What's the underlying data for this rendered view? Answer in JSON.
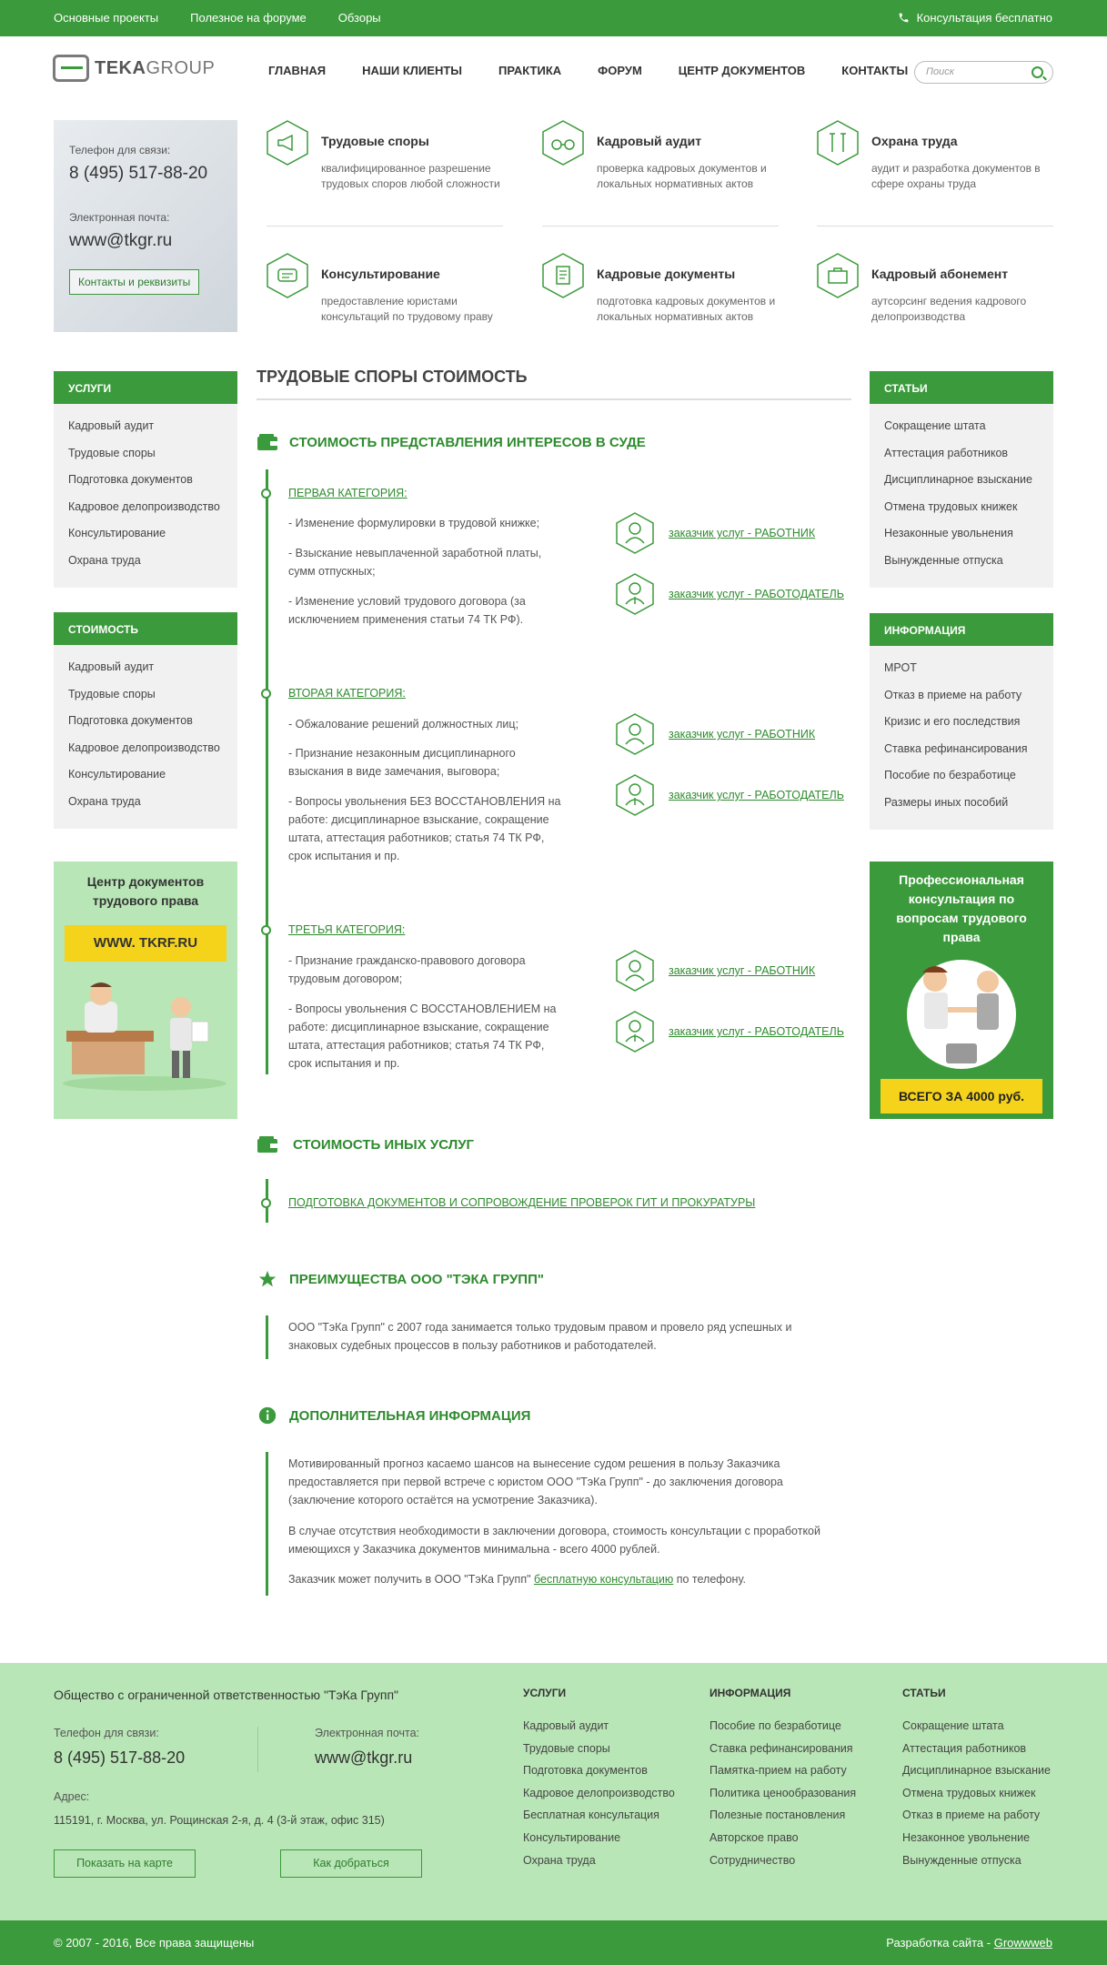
{
  "topbar": {
    "links": [
      "Основные проекты",
      "Полезное на форуме",
      "Обзоры"
    ],
    "consult": "Консультация бесплатно"
  },
  "header": {
    "logo_a": "TEKA",
    "logo_b": "GROUP",
    "nav": [
      "ГЛАВНАЯ",
      "НАШИ КЛИЕНТЫ",
      "ПРАКТИКА",
      "ФОРУМ",
      "ЦЕНТР ДОКУМЕНТОВ",
      "КОНТАКТЫ"
    ],
    "search_placeholder": "Поиск"
  },
  "contact_card": {
    "phone_label": "Телефон для связи:",
    "phone": "8 (495) 517-88-20",
    "email_label": "Электронная почта:",
    "email": "www@tkgr.ru",
    "button": "Контакты и реквизиты"
  },
  "services": [
    {
      "title": "Трудовые споры",
      "desc": "квалифицированное разрешение трудовых споров любой сложности"
    },
    {
      "title": "Кадровый аудит",
      "desc": "проверка кадровых документов и локальных нормативных актов"
    },
    {
      "title": "Охрана труда",
      "desc": "аудит и разработка документов в сфере охраны труда"
    },
    {
      "title": "Консультирование",
      "desc": "предоставление юристами консультаций по трудовому праву"
    },
    {
      "title": "Кадровые документы",
      "desc": "подготовка кадровых документов и локальных нормативных актов"
    },
    {
      "title": "Кадровый абонемент",
      "desc": "аутсорсинг ведения кадрового делопроизводства"
    }
  ],
  "left_sidebar": {
    "services_title": "УСЛУГИ",
    "services": [
      "Кадровый аудит",
      "Трудовые споры",
      "Подготовка документов",
      "Кадровое делопроизводство",
      "Консультирование",
      "Охрана труда"
    ],
    "cost_title": "СТОИМОСТЬ",
    "cost": [
      "Кадровый аудит",
      "Трудовые споры",
      "Подготовка документов",
      "Кадровое делопроизводство",
      "Консультирование",
      "Охрана труда"
    ],
    "promo_title": "Центр документов трудового права",
    "promo_site": "WWW. TKRF.RU"
  },
  "right_sidebar": {
    "articles_title": "СТАТЬИ",
    "articles": [
      "Сокращение штата",
      "Аттестация работников",
      "Дисциплинарное взыскание",
      "Отмена трудовых книжек",
      "Незаконные увольнения",
      "Вынужденные отпуска"
    ],
    "info_title": "ИНФОРМАЦИЯ",
    "info": [
      "МРОТ",
      "Отказ в приеме на работу",
      "Кризис и его последствия",
      "Ставка рефинансирования",
      "Пособие по безработице",
      "Размеры иных пособий"
    ],
    "promo_title": "Профессиональная консультация по вопросам трудового права",
    "promo_price": "ВСЕГО ЗА 4000 руб."
  },
  "main": {
    "title": "ТРУДОВЫЕ СПОРЫ СТОИМОСТЬ",
    "court_title": "СТОИМОСТЬ ПРЕДСТАВЛЕНИЯ ИНТЕРЕСОВ В СУДЕ",
    "employee_link": "заказчик услуг - РАБОТНИК",
    "employer_link": "заказчик услуг - РАБОТОДАТЕЛЬ",
    "categories": [
      {
        "name": "ПЕРВАЯ КАТЕГОРИЯ:",
        "items": [
          "- Изменение формулировки в трудовой книжке;",
          "- Взыскание невыплаченной заработной платы, сумм отпускных;",
          "- Изменение условий трудового договора (за исключением применения статьи 74 ТК РФ)."
        ]
      },
      {
        "name": "ВТОРАЯ КАТЕГОРИЯ:",
        "items": [
          "- Обжалование решений должностных лиц;",
          "- Признание незаконным дисциплинарного взыскания в виде замечания, выговора;",
          "- Вопросы увольнения БЕЗ ВОССТАНОВЛЕНИЯ на работе: дисциплинарное взыскание, сокращение штата, аттестация работников; статья 74 ТК РФ, срок испытания и пр."
        ]
      },
      {
        "name": "ТРЕТЬЯ КАТЕГОРИЯ:",
        "items": [
          "- Признание гражданско-правового договора трудовым договором;",
          "- Вопросы увольнения С ВОССТАНОВЛЕНИЕМ на работе: дисциплинарное взыскание, сокращение штата, аттестация работников; статья 74 ТК РФ, срок испытания и пр."
        ]
      }
    ],
    "other_title": "СТОИМОСТЬ ИНЫХ УСЛУГ",
    "other_link": "ПОДГОТОВКА ДОКУМЕНТОВ И СОПРОВОЖДЕНИЕ ПРОВЕРОК ГИТ И ПРОКУРАТУРЫ",
    "adv_title": "ПРЕИМУЩЕСТВА ООО \"ТЭКА ГРУПП\"",
    "adv_text": "ООО \"ТэКа Групп\" с 2007 года занимается только трудовым правом и провело ряд успешных и знаковых судебных процессов в пользу работников и работодателей.",
    "info_title": "ДОПОЛНИТЕЛЬНАЯ ИНФОРМАЦИЯ",
    "info_p1": "Мотивированный прогноз касаемо шансов на вынесение судом решения в пользу Заказчика предоставляется при первой встрече с юристом ООО \"ТэКа Групп\" - до заключения договора (заключение которого остаётся на усмотрение Заказчика).",
    "info_p2": "В случае отсутствия необходимости в заключении договора, стоимость консультации с проработкой имеющихся у Заказчика документов минимальна - всего 4000 рублей.",
    "info_p3_a": "Заказчик может получить в ООО \"ТэКа Групп\" ",
    "info_p3_link": "бесплатную консультацию",
    "info_p3_b": " по телефону."
  },
  "footer": {
    "company": "Общество с ограниченной ответственностью \"ТэКа Групп\"",
    "phone_label": "Телефон для связи:",
    "phone": "8 (495) 517-88-20",
    "email_label": "Электронная почта:",
    "email": "www@tkgr.ru",
    "address_label": "Адрес:",
    "address": "115191, г. Москва, ул. Рощинская 2-я, д. 4 (3-й этаж, офис 315)",
    "map_button": "Показать на карте",
    "route_button": "Как добраться",
    "services_title": "УСЛУГИ",
    "services": [
      "Кадровый аудит",
      "Трудовые споры",
      "Подготовка документов",
      "Кадровое делопроизводство",
      "Бесплатная консультация",
      "Консультирование",
      "Охрана труда"
    ],
    "info_title": "ИНФОРМАЦИЯ",
    "info": [
      "Пособие по безработице",
      "Ставка рефинансирования",
      "Памятка-прием на работу",
      "Политика ценообразования",
      "Полезные постановления",
      "Авторское право",
      "Сотрудничество"
    ],
    "articles_title": "СТАТЬИ",
    "articles": [
      "Сокращение штата",
      "Аттестация работников",
      "Дисциплинарное взыскание",
      "Отмена трудовых книжек",
      "Отказ в приеме на работу",
      "Незаконное увольнение",
      "Вынужденные отпуска"
    ],
    "copyright": "© 2007 - 2016, Все права защищены",
    "dev_label": "Разработка сайта - ",
    "dev_link": "Growwweb"
  },
  "colors": {
    "green": "#3b9a3b",
    "light_green": "#b9e6b6",
    "yellow": "#f5d31a"
  }
}
